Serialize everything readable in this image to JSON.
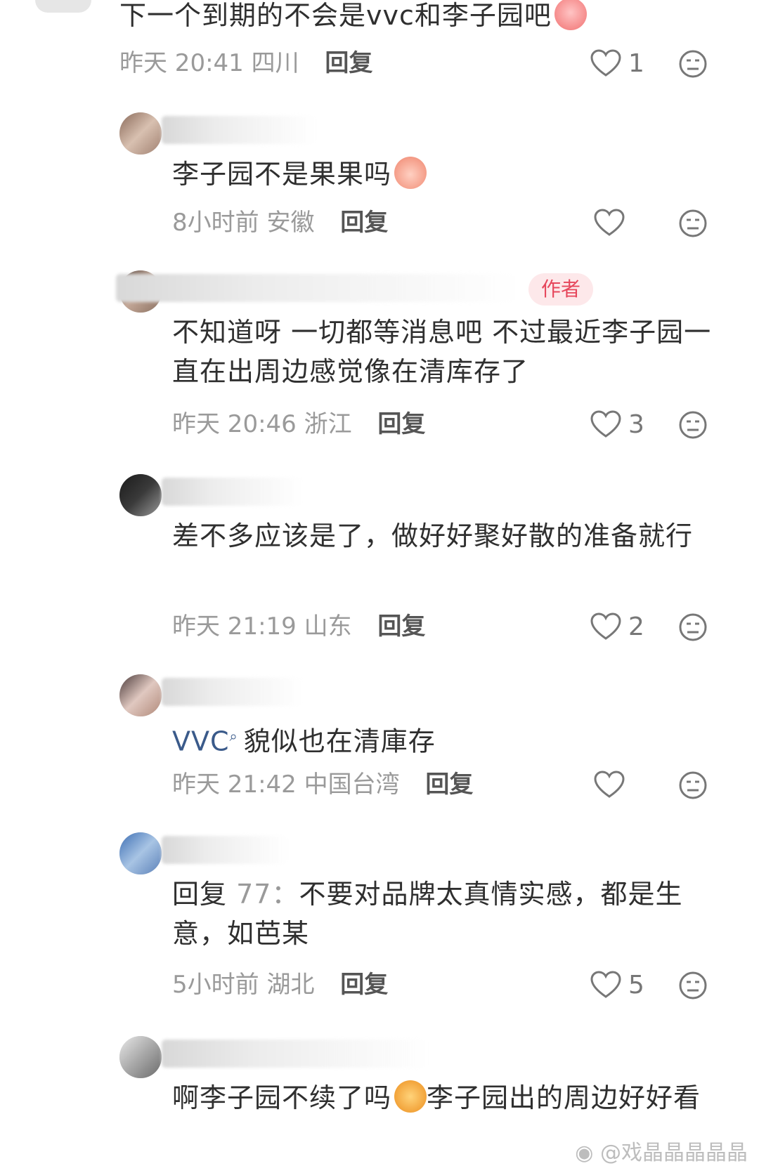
{
  "comments": [
    {
      "text": "下一个到期的不会是vvc和李子园吧",
      "emoji": "crying-face-icon",
      "time": "昨天 20:41",
      "location": "四川",
      "reply_label": "回复",
      "likes": "1"
    },
    {
      "text": "李子园不是果果吗",
      "emoji": "peach-cry-icon",
      "time": "8小时前",
      "location": "安徽",
      "reply_label": "回复",
      "likes": ""
    },
    {
      "author_badge": "作者",
      "text": "不知道呀 一切都等消息吧 不过最近李子园一直在出周边感觉像在清库存了",
      "time": "昨天 20:46",
      "location": "浙江",
      "reply_label": "回复",
      "likes": "3"
    },
    {
      "text": "差不多应该是了，做好好聚好散的准备就行",
      "time": "昨天 21:19",
      "location": "山东",
      "reply_label": "回复",
      "likes": "2"
    },
    {
      "mention": "VVC",
      "text": "貌似也在清庫存",
      "time": "昨天 21:42",
      "location": "中国台湾",
      "reply_label": "回复",
      "likes": ""
    },
    {
      "reply_prefix": "回复",
      "reply_to": "77：",
      "text": "不要对品牌太真情实感，都是生意，如芭某",
      "time": "5小时前",
      "location": "湖北",
      "reply_label": "回复",
      "likes": "5"
    },
    {
      "text_a": "啊李子园不续了吗",
      "emoji": "crying-cat-icon",
      "text_b": "李子园出的周边好好看"
    }
  ],
  "watermark": "@戏晶晶晶晶晶",
  "colors": {
    "meta": "#9a9a9a",
    "badge_bg": "#fde8ea",
    "badge_text": "#e6475c",
    "mention": "#3a5a8a"
  }
}
